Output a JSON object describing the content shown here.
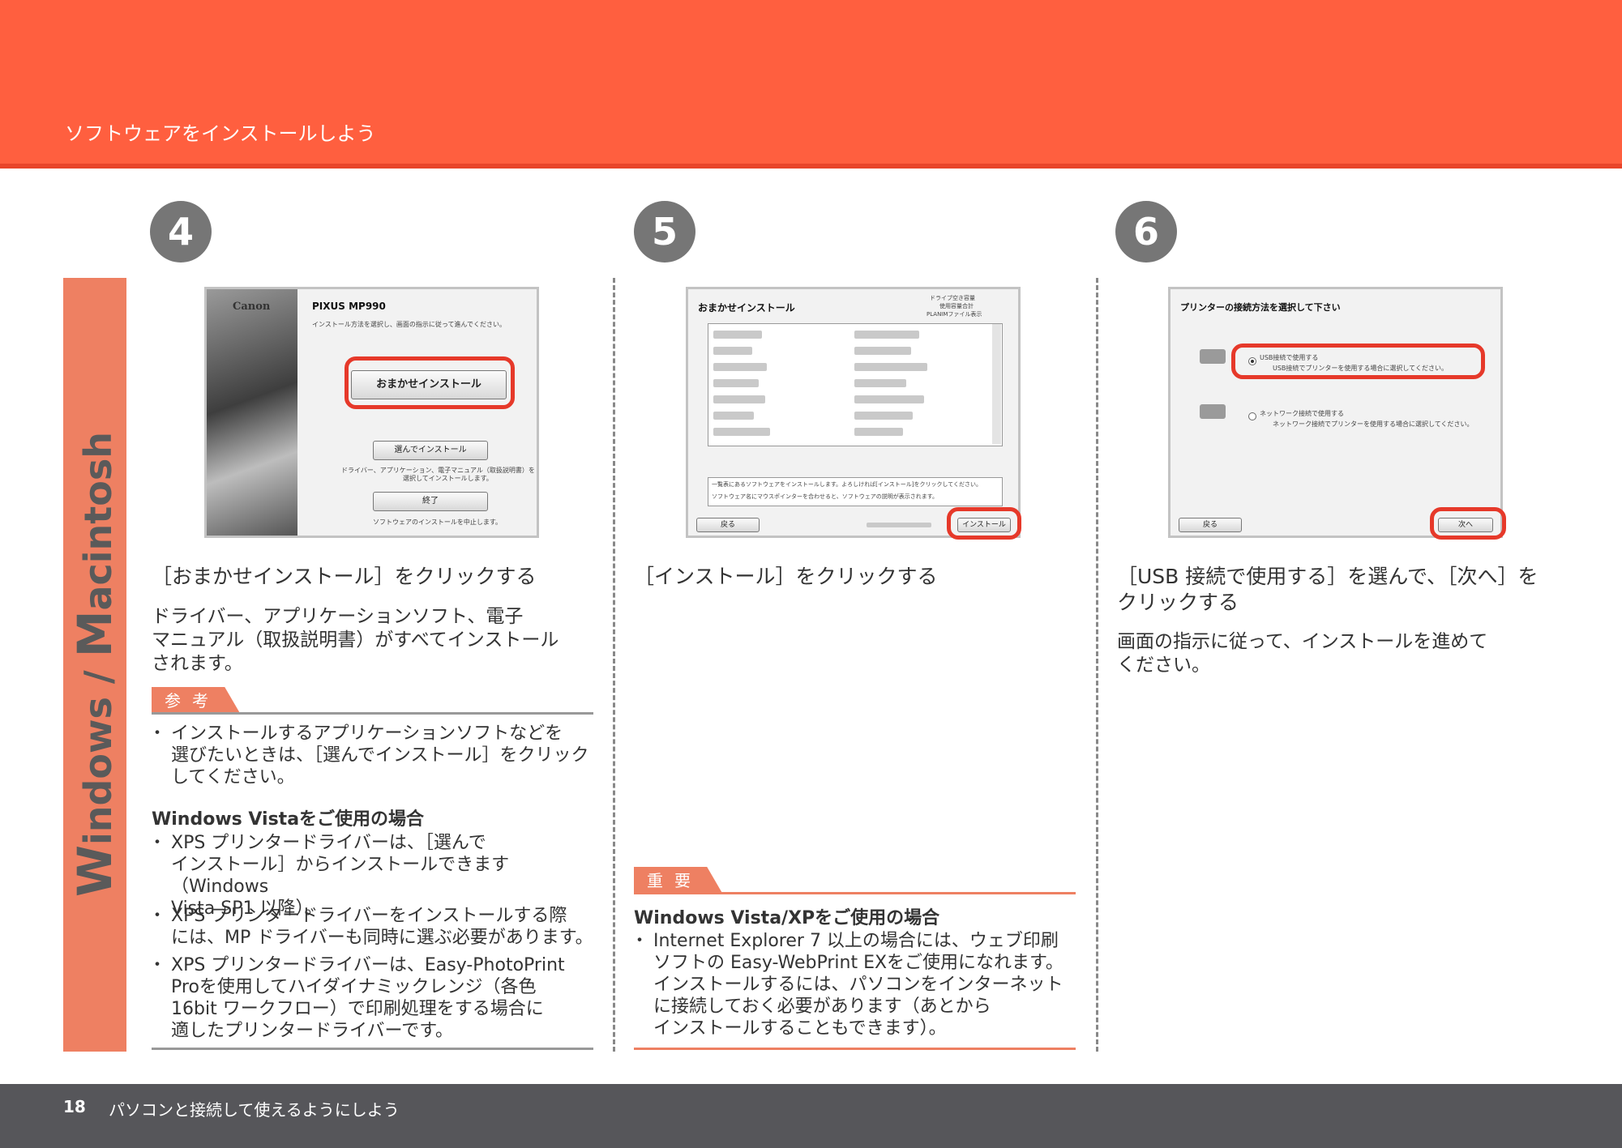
{
  "header": {
    "title": "ソフトウェアをインストールしよう"
  },
  "sidebar": {
    "first_initial": "W",
    "first_rest": "indows",
    "sep": " / ",
    "second_initial": "M",
    "second_rest": "acintosh"
  },
  "steps": [
    {
      "number": "4",
      "heading": "［おまかせインストール］をクリックする",
      "body": [
        "ドライバー、アプリケーションソフト、電子",
        "マニュアル（取扱説明書）がすべてインストール",
        "されます。"
      ],
      "screenshot": {
        "brand": "Canon",
        "model": "PIXUS MP990",
        "instruction": "インストール方法を選択し、画面の指示に従って進んでください。",
        "button_main": "おまかせインストール",
        "button_select": "選んでインストール",
        "select_desc": [
          "ドライバー、アプリケーション、電子マニュアル（取扱説明書）を",
          "選択してインストールします。"
        ],
        "button_exit": "終了",
        "exit_desc": "ソフトウェアのインストールを中止します。"
      }
    },
    {
      "number": "5",
      "heading": "［インストール］をクリックする",
      "screenshot": {
        "title": "おまかせインストール",
        "info1": "ドライブ空き容量",
        "info2": "使用容量合計",
        "info3": "PLANIMファイル表示",
        "note1": "一覧表にあるソフトウェアをインストールします。よろしければ[インストール]をクリックしてください。",
        "note2": "ソフトウェア名にマウスポインターを合わせると、ソフトウェアの説明が表示されます。",
        "button_back": "戻る",
        "button_install": "インストール"
      }
    },
    {
      "number": "6",
      "heading": [
        "［USB 接続で使用する］を選んで、［次へ］を",
        "クリックする"
      ],
      "body": [
        "画面の指示に従って、インストールを進めて",
        "ください。"
      ],
      "screenshot": {
        "title": "プリンターの接続方法を選択して下さい",
        "opt1": "USB接続で使用する",
        "opt1_desc": "USB接続でプリンターを使用する場合に選択してください。",
        "opt2": "ネットワーク接続で使用する",
        "opt2_desc": "ネットワーク接続でプリンターを使用する場合に選択してください。",
        "button_back": "戻る",
        "button_next": "次へ"
      }
    }
  ],
  "reference": {
    "tag": "参考",
    "item": [
      "インストールするアプリケーションソフトなどを",
      "選びたいときは、［選んでインストール］をクリック",
      "してください。"
    ],
    "subheading": "Windows Vistaをご使用の場合",
    "items": [
      [
        "XPS プリンタードライバーは、［選んで",
        "インストール］からインストールできます（Windows",
        "Vista SP1 以降）。"
      ],
      [
        "XPS プリンタードライバーをインストールする際",
        "には、MP ドライバーも同時に選ぶ必要があります。"
      ],
      [
        "XPS プリンタードライバーは、Easy-PhotoPrint",
        "Proを使用してハイダイナミックレンジ（各色",
        "16bit ワークフロー）で印刷処理をする場合に",
        "適したプリンタードライバーです。"
      ]
    ]
  },
  "important": {
    "tag": "重要",
    "subheading": "Windows Vista/XPをご使用の場合",
    "item": [
      "Internet Explorer 7 以上の場合には、ウェブ印刷",
      "ソフトの Easy-WebPrint EXをご使用になれます。",
      "インストールするには、パソコンをインターネット",
      "に接続しておく必要があります（あとから",
      "インストールすることもできます）。"
    ]
  },
  "footer": {
    "page": "18",
    "text": "パソコンと接続して使えるようにしよう"
  }
}
